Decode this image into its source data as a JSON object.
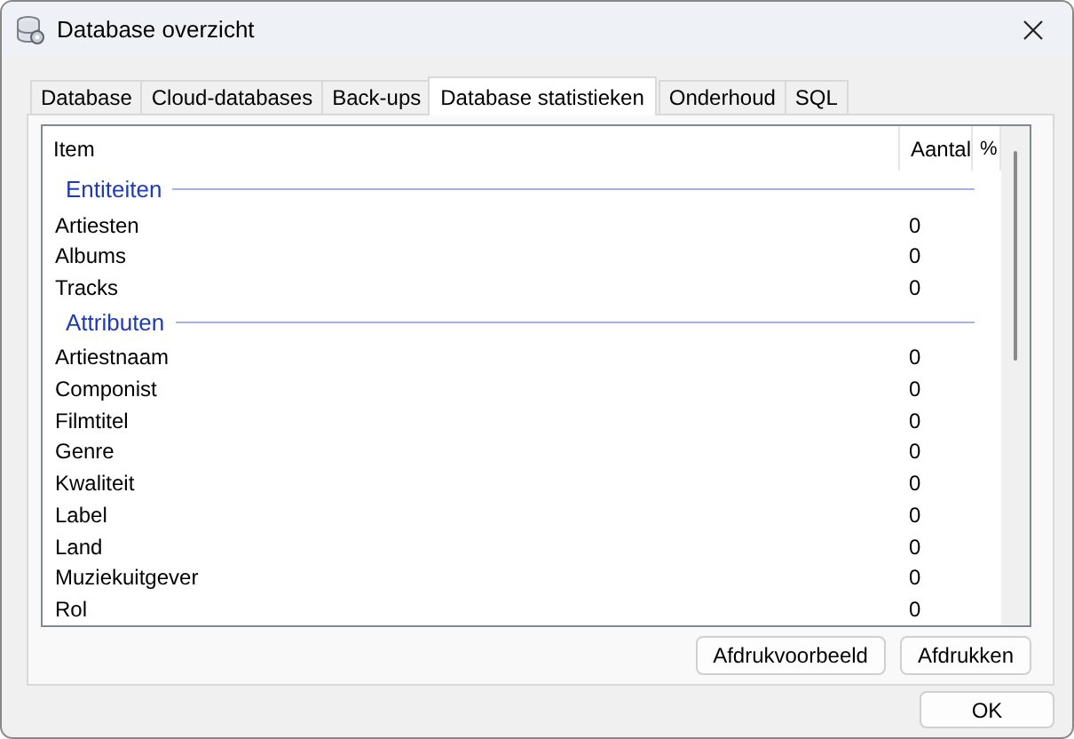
{
  "window": {
    "title": "Database overzicht"
  },
  "tabs": [
    {
      "label": "Database",
      "selected": false
    },
    {
      "label": "Cloud-databases",
      "selected": false
    },
    {
      "label": "Back-ups",
      "selected": false
    },
    {
      "label": "Database statistieken",
      "selected": true
    },
    {
      "label": "Onderhoud",
      "selected": false
    },
    {
      "label": "SQL",
      "selected": false
    }
  ],
  "table": {
    "columns": [
      "Item",
      "Aantal",
      "%"
    ],
    "groups": [
      {
        "title": "Entiteiten",
        "rows": [
          {
            "item": "Artiesten",
            "count": "0"
          },
          {
            "item": "Albums",
            "count": "0"
          },
          {
            "item": "Tracks",
            "count": "0"
          }
        ]
      },
      {
        "title": "Attributen",
        "rows": [
          {
            "item": "Artiestnaam",
            "count": "0"
          },
          {
            "item": "Componist",
            "count": "0"
          },
          {
            "item": "Filmtitel",
            "count": "0"
          },
          {
            "item": "Genre",
            "count": "0"
          },
          {
            "item": "Kwaliteit",
            "count": "0"
          },
          {
            "item": "Label",
            "count": "0"
          },
          {
            "item": "Land",
            "count": "0"
          },
          {
            "item": "Muziekuitgever",
            "count": "0"
          },
          {
            "item": "Rol",
            "count": "0"
          }
        ]
      }
    ]
  },
  "panel_buttons": [
    "Afdrukvoorbeeld",
    "Afdrukken"
  ],
  "dialog_buttons": [
    "OK"
  ]
}
